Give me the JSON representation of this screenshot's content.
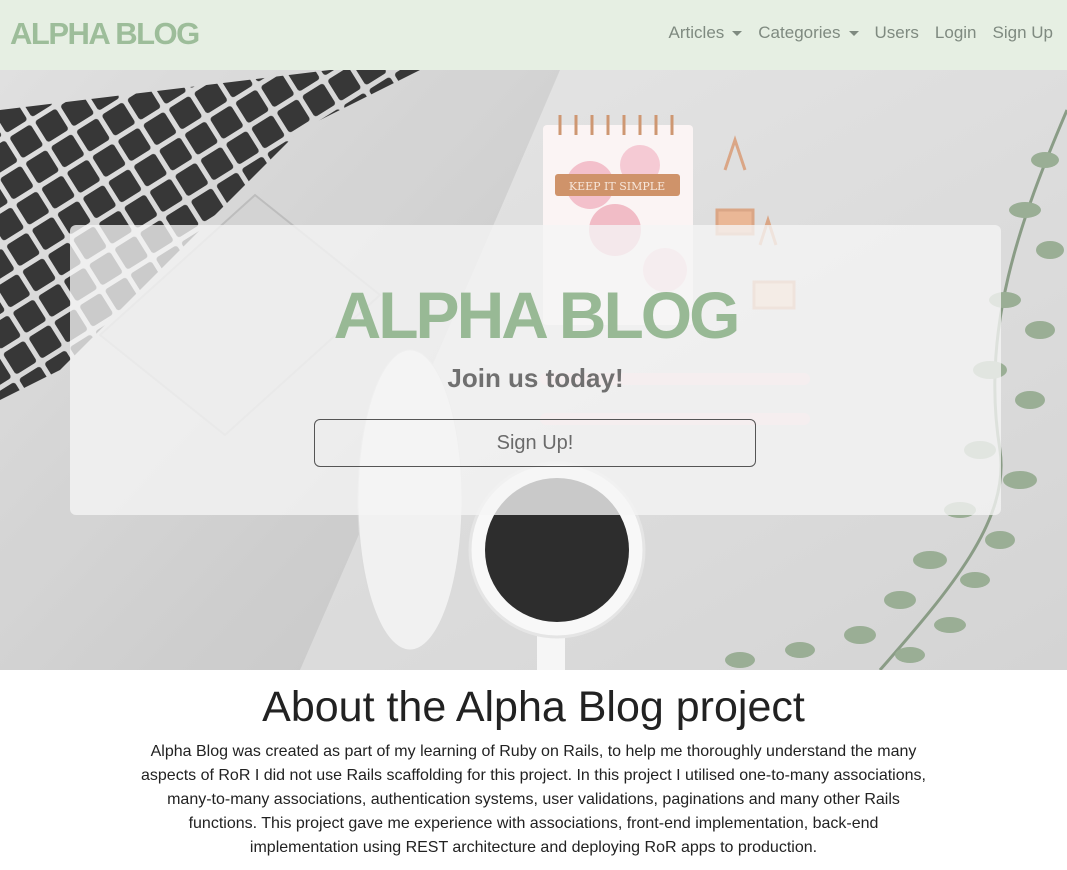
{
  "navbar": {
    "brand": "ALPHA BLOG",
    "links": [
      {
        "label": "Articles",
        "dropdown": true
      },
      {
        "label": "Categories",
        "dropdown": true
      },
      {
        "label": "Users",
        "dropdown": false
      },
      {
        "label": "Login",
        "dropdown": false
      },
      {
        "label": "Sign Up",
        "dropdown": false
      }
    ]
  },
  "hero": {
    "title": "ALPHA BLOG",
    "subtitle": "Join us today!",
    "button_label": "Sign Up!",
    "notepad_text": "KEEP IT SIMPLE"
  },
  "about": {
    "title": "About the Alpha Blog project",
    "text": "Alpha Blog was created as part of my learning of Ruby on Rails, to help me thoroughly understand the many aspects of RoR I did not use Rails scaffolding for this project. In this project I utilised one-to-many associations, many-to-many associations, authentication systems, user validations, paginations and many other Rails functions. This project gave me experience with associations, front-end implementation, back-end implementation using REST architecture and deploying RoR apps to production."
  },
  "colors": {
    "navbar_bg": "#e6efe3",
    "brand": "#9dbd9a",
    "nav_link": "#7f8a80",
    "hero_title": "#98b995",
    "hero_subtitle": "#707070"
  }
}
